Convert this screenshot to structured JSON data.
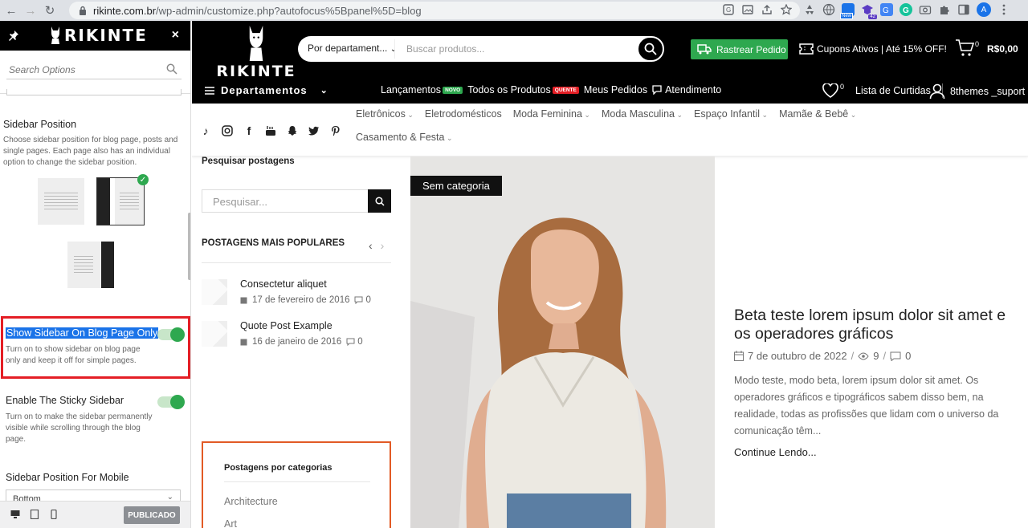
{
  "browser": {
    "url_host": "rikinte.com.br",
    "url_path": "/wp-admin/customize.php?autofocus%5Bpanel%5D=blog",
    "profile_initial": "A",
    "ext_badge_new": "New",
    "ext_badge_count": "42"
  },
  "panel": {
    "logo_text": "RIKINTE",
    "close_symbol": "×",
    "search_placeholder": "Search Options",
    "sidebar_position": {
      "title": "Sidebar Position",
      "description": "Choose sidebar position for blog page, posts and single pages. Each page also has an individual option to change the sidebar position."
    },
    "show_sidebar_blog": {
      "label": "Show Sidebar On Blog Page Only",
      "description": "Turn on to show sidebar on blog page only and keep it off for simple pages.",
      "enabled": true
    },
    "sticky_sidebar": {
      "label": "Enable The Sticky Sidebar",
      "description": "Turn on to make the sidebar permanently visible while scrolling through the blog page.",
      "enabled": true
    },
    "mobile_position": {
      "label": "Sidebar Position For Mobile",
      "value": "Bottom"
    },
    "publish_label": "PUBLICADO"
  },
  "site": {
    "logo_text": "RIKINTE",
    "search": {
      "department": "Por departament...",
      "placeholder": "Buscar produtos..."
    },
    "track_label": "Rastrear Pedido",
    "coupons_label": "Cupons Ativos | Até 15% OFF!",
    "cart_count": "0",
    "cart_total": "R$0,00",
    "departments_label": "Departamentos",
    "topnav": {
      "launches": "Lançamentos",
      "badge_new": "NOVO",
      "all_products": "Todos os Produtos",
      "badge_hot": "QUENTE",
      "orders": "Meus Pedidos",
      "support": "Atendimento"
    },
    "wishlist_count": "0",
    "wishlist_label": "Lista de Curtidas",
    "account_label": "8themes _suport",
    "categories": [
      "Eletrônicos",
      "Eletrodomésticos",
      "Moda Feminina",
      "Moda Masculina",
      "Espaço Infantil",
      "Mamãe & Bebê",
      "Casamento & Festa"
    ]
  },
  "blog_sidebar": {
    "search_title": "Pesquisar postagens",
    "search_placeholder": "Pesquisar...",
    "popular_title": "POSTAGENS MAIS POPULARES",
    "popular": [
      {
        "title": "Consectetur aliquet",
        "date": "17 de fevereiro de 2016",
        "comments": "0"
      },
      {
        "title": "Quote Post Example",
        "date": "16 de janeiro de 2016",
        "comments": "0"
      }
    ],
    "categories_title": "Postagens por categorias",
    "categories": [
      "Architecture",
      "Art"
    ]
  },
  "post": {
    "category": "Sem categoria",
    "title": "Beta teste lorem ipsum dolor sit amet e os operadores gráficos",
    "date": "7 de outubro de 2022",
    "views": "9",
    "comments": "0",
    "excerpt": "Modo teste, modo beta, lorem ipsum dolor sit amet. Os operadores gráficos e tipográficos sabem disso bem, na realidade, todas as profissões que lidam com o universo da comunicação têm...",
    "read_more": "Continue Lendo..."
  }
}
